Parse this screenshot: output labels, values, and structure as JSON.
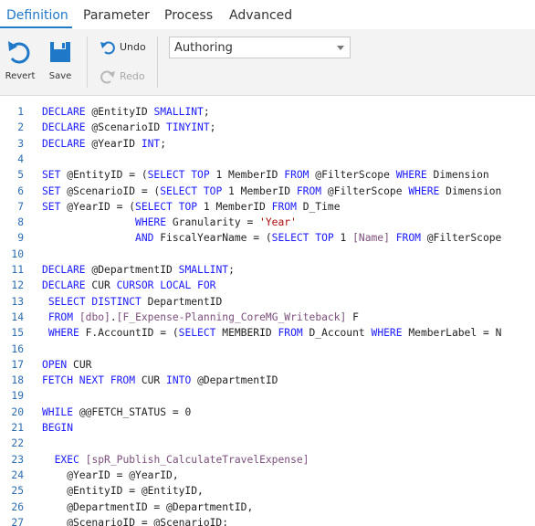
{
  "tabs": [
    {
      "label": "Definition",
      "active": true
    },
    {
      "label": "Parameter",
      "active": false
    },
    {
      "label": "Process",
      "active": false
    },
    {
      "label": "Advanced",
      "active": false
    }
  ],
  "ribbon": {
    "revert_label": "Revert",
    "save_label": "Save",
    "undo_label": "Undo",
    "redo_label": "Redo",
    "mode_value": "Authoring"
  },
  "colors": {
    "accent": "#1f78c8",
    "keyword": "#1a1aff",
    "string": "#b00d0d",
    "bracket_identifier": "#7b4f7b",
    "line_number": "#2b6cb0",
    "disabled": "#a8a8a8"
  },
  "editor": {
    "lines": [
      {
        "n": "1",
        "tokens": [
          [
            "kw",
            "DECLARE"
          ],
          [
            "plain",
            " @EntityID "
          ],
          [
            "kw",
            "SMALLINT"
          ],
          [
            "plain",
            ";"
          ]
        ]
      },
      {
        "n": "2",
        "tokens": [
          [
            "kw",
            "DECLARE"
          ],
          [
            "plain",
            " @ScenarioID "
          ],
          [
            "kw",
            "TINYINT"
          ],
          [
            "plain",
            ";"
          ]
        ]
      },
      {
        "n": "3",
        "tokens": [
          [
            "kw",
            "DECLARE"
          ],
          [
            "plain",
            " @YearID "
          ],
          [
            "kw",
            "INT"
          ],
          [
            "plain",
            ";"
          ]
        ]
      },
      {
        "n": "4",
        "tokens": []
      },
      {
        "n": "5",
        "tokens": [
          [
            "kw",
            "SET"
          ],
          [
            "plain",
            " @EntityID = ("
          ],
          [
            "kw",
            "SELECT TOP"
          ],
          [
            "plain",
            " 1 MemberID "
          ],
          [
            "kw",
            "FROM"
          ],
          [
            "plain",
            " @FilterScope "
          ],
          [
            "kw",
            "WHERE"
          ],
          [
            "plain",
            " Dimension"
          ]
        ]
      },
      {
        "n": "6",
        "tokens": [
          [
            "kw",
            "SET"
          ],
          [
            "plain",
            " @ScenarioID = ("
          ],
          [
            "kw",
            "SELECT TOP"
          ],
          [
            "plain",
            " 1 MemberID "
          ],
          [
            "kw",
            "FROM"
          ],
          [
            "plain",
            " @FilterScope "
          ],
          [
            "kw",
            "WHERE"
          ],
          [
            "plain",
            " Dimension"
          ]
        ]
      },
      {
        "n": "7",
        "tokens": [
          [
            "kw",
            "SET"
          ],
          [
            "plain",
            " @YearID = ("
          ],
          [
            "kw",
            "SELECT TOP"
          ],
          [
            "plain",
            " 1 MemberID "
          ],
          [
            "kw",
            "FROM"
          ],
          [
            "plain",
            " D_Time"
          ]
        ]
      },
      {
        "n": "8",
        "tokens": [
          [
            "plain",
            "               "
          ],
          [
            "kw",
            "WHERE"
          ],
          [
            "plain",
            " Granularity = "
          ],
          [
            "str",
            "'Year'"
          ]
        ]
      },
      {
        "n": "9",
        "tokens": [
          [
            "plain",
            "               "
          ],
          [
            "kw",
            "AND"
          ],
          [
            "plain",
            " FiscalYearName = ("
          ],
          [
            "kw",
            "SELECT TOP"
          ],
          [
            "plain",
            " 1 "
          ],
          [
            "id",
            "[Name]"
          ],
          [
            "plain",
            " "
          ],
          [
            "kw",
            "FROM"
          ],
          [
            "plain",
            " @FilterScope"
          ]
        ]
      },
      {
        "n": "10",
        "tokens": []
      },
      {
        "n": "11",
        "tokens": [
          [
            "kw",
            "DECLARE"
          ],
          [
            "plain",
            " @DepartmentID "
          ],
          [
            "kw",
            "SMALLINT"
          ],
          [
            "plain",
            ";"
          ]
        ]
      },
      {
        "n": "12",
        "tokens": [
          [
            "kw",
            "DECLARE"
          ],
          [
            "plain",
            " CUR "
          ],
          [
            "kw",
            "CURSOR LOCAL FOR"
          ]
        ]
      },
      {
        "n": "13",
        "tokens": [
          [
            "plain",
            " "
          ],
          [
            "kw",
            "SELECT DISTINCT"
          ],
          [
            "plain",
            " DepartmentID"
          ]
        ]
      },
      {
        "n": "14",
        "tokens": [
          [
            "plain",
            " "
          ],
          [
            "kw",
            "FROM"
          ],
          [
            "plain",
            " "
          ],
          [
            "id",
            "[dbo]"
          ],
          [
            "plain",
            "."
          ],
          [
            "id",
            "[F_Expense-Planning_CoreMG_Writeback]"
          ],
          [
            "plain",
            " F"
          ]
        ]
      },
      {
        "n": "15",
        "tokens": [
          [
            "plain",
            " "
          ],
          [
            "kw",
            "WHERE"
          ],
          [
            "plain",
            " F.AccountID = ("
          ],
          [
            "kw",
            "SELECT"
          ],
          [
            "plain",
            " MEMBERID "
          ],
          [
            "kw",
            "FROM"
          ],
          [
            "plain",
            " D_Account "
          ],
          [
            "kw",
            "WHERE"
          ],
          [
            "plain",
            " MemberLabel = N"
          ]
        ]
      },
      {
        "n": "16",
        "tokens": []
      },
      {
        "n": "17",
        "tokens": [
          [
            "kw",
            "OPEN"
          ],
          [
            "plain",
            " CUR"
          ]
        ]
      },
      {
        "n": "18",
        "tokens": [
          [
            "kw",
            "FETCH NEXT FROM"
          ],
          [
            "plain",
            " CUR "
          ],
          [
            "kw",
            "INTO"
          ],
          [
            "plain",
            " @DepartmentID"
          ]
        ]
      },
      {
        "n": "19",
        "tokens": []
      },
      {
        "n": "20",
        "tokens": [
          [
            "kw",
            "WHILE"
          ],
          [
            "plain",
            " @@FETCH_STATUS = 0"
          ]
        ]
      },
      {
        "n": "21",
        "tokens": [
          [
            "kw",
            "BEGIN"
          ]
        ]
      },
      {
        "n": "22",
        "tokens": []
      },
      {
        "n": "23",
        "tokens": [
          [
            "plain",
            "  "
          ],
          [
            "kw",
            "EXEC"
          ],
          [
            "plain",
            " "
          ],
          [
            "id",
            "[spR_Publish_CalculateTravelExpense]"
          ]
        ]
      },
      {
        "n": "24",
        "tokens": [
          [
            "plain",
            "    @YearID = @YearID,"
          ]
        ]
      },
      {
        "n": "25",
        "tokens": [
          [
            "plain",
            "    @EntityID = @EntityID,"
          ]
        ]
      },
      {
        "n": "26",
        "tokens": [
          [
            "plain",
            "    @DepartmentID = @DepartmentID,"
          ]
        ]
      },
      {
        "n": "27",
        "tokens": [
          [
            "plain",
            "    @ScenarioID = @ScenarioID;"
          ]
        ]
      }
    ]
  }
}
